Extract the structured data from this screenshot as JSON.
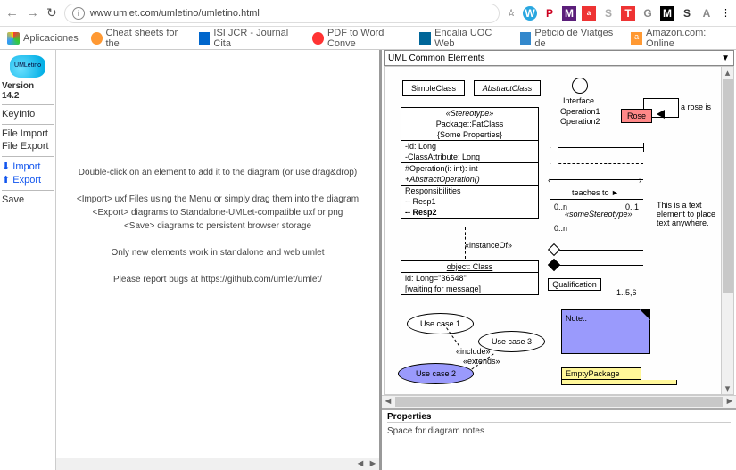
{
  "browser": {
    "url": "www.umlet.com/umletino/umletino.html",
    "nav_back": "←",
    "nav_fwd": "→",
    "reload": "↻",
    "info": "i",
    "star": "☆",
    "menu": "⋮"
  },
  "toolbar_icons": [
    "W",
    "P",
    "M",
    "a",
    "S",
    "T",
    "G",
    "M",
    "S",
    "A"
  ],
  "bookmarks": [
    {
      "icon_color": "#f33",
      "label": "Aplicaciones"
    },
    {
      "icon_color": "#f93",
      "label": "Cheat sheets for the"
    },
    {
      "icon_color": "#06c",
      "label": "ISI JCR - Journal Cita"
    },
    {
      "icon_color": "#f33",
      "label": "PDF to Word Conve"
    },
    {
      "icon_color": "#069",
      "label": "Endalia UOC Web"
    },
    {
      "icon_color": "#38c",
      "label": "Petició de Viatges de"
    },
    {
      "icon_color": "#f93",
      "label": "Amazon.com: Online"
    }
  ],
  "sidebar": {
    "logo": "UMLetino",
    "version": "Version 14.2",
    "keyinfo": "KeyInfo",
    "file": [
      "File Import",
      "File Export"
    ],
    "transfer": [
      {
        "glyph": "⬇",
        "label": "Import"
      },
      {
        "glyph": "⬆",
        "label": "Export"
      }
    ],
    "save": "Save"
  },
  "canvas": {
    "l1": "Double-click on an element to add it to the diagram (or use drag&drop)",
    "l2": "<Import> uxf Files using the Menu or simply drag them into the diagram",
    "l3": "<Export> diagrams to Standalone-UMLet-compatible uxf or png",
    "l4": "<Save> diagrams to persistent browser storage",
    "l5": "Only new elements work in standalone and web umlet",
    "l6": "Please report bugs at https://github.com/umlet/umlet/"
  },
  "palette": {
    "title": "UML Common Elements",
    "simple": "SimpleClass",
    "abstract": "AbstractClass",
    "fatclass": {
      "stereo": "«Stereotype»",
      "pkg": "Package::FatClass",
      "props": "{Some Properties}",
      "id": "-id: Long",
      "clsattr": "-ClassAttribute: Long",
      "op": "#Operation(i: int): int",
      "absop": "+AbstractOperation()",
      "resp": "Responsibilities",
      "r1": "-- Resp1",
      "r2": "-- Resp2"
    },
    "objclass": {
      "title": "object: Class",
      "id": "id: Long=\"36548\"",
      "wait": "[waiting for message]"
    },
    "usecase1": "Use case 1",
    "usecase2": "Use case 2",
    "usecase3": "Use case 3",
    "include": "«include»",
    "extends": "«extends»",
    "instanceof": "«instanceOf»",
    "interface": "Interface",
    "op1": "Operation1",
    "op2": "Operation2",
    "teaches": "teaches to ►",
    "somestereo": "«someStereotype»",
    "n0n_a": "0..n",
    "n0n_b": "0..1",
    "n0n_c": "0..n",
    "rose": "Rose",
    "arose": "a rose is",
    "textelem": "This is a text element to place text anywhere.",
    "qual": "Qualification",
    "mult": "1..5,6",
    "note": "Note..",
    "empty": "EmptyPackage"
  },
  "props": {
    "title": "Properties",
    "body": "Space for diagram notes"
  }
}
